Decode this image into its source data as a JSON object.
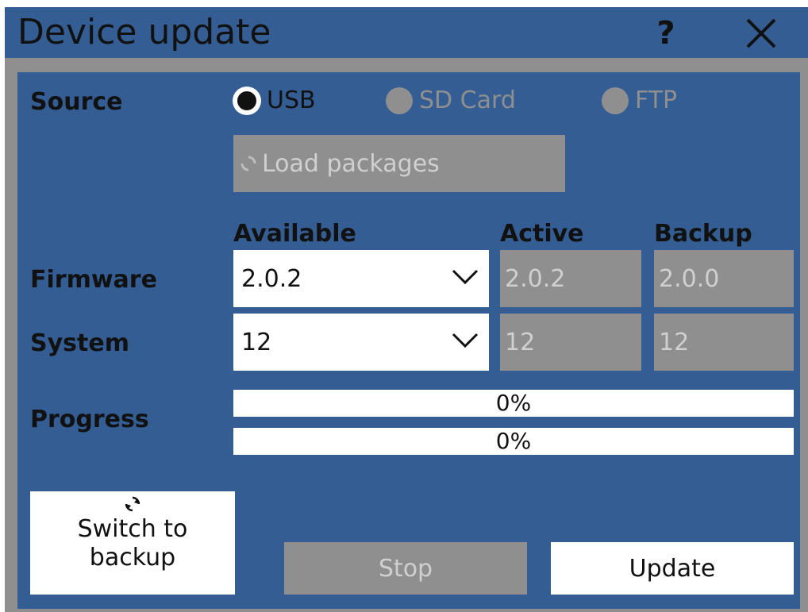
{
  "window": {
    "title": "Device update",
    "help_icon": "question-mark",
    "close_icon": "x-close"
  },
  "source": {
    "label": "Source",
    "options": [
      {
        "label": "USB",
        "selected": true,
        "enabled": true
      },
      {
        "label": "SD Card",
        "selected": false,
        "enabled": false
      },
      {
        "label": "FTP",
        "selected": false,
        "enabled": false
      }
    ]
  },
  "load_packages": {
    "label": "Load packages",
    "icon": "refresh-icon",
    "enabled": false
  },
  "columns": {
    "available": "Available",
    "active": "Active",
    "backup": "Backup"
  },
  "firmware": {
    "label": "Firmware",
    "available": "2.0.2",
    "active": "2.0.2",
    "backup": "2.0.0"
  },
  "system": {
    "label": "System",
    "available": "12",
    "active": "12",
    "backup": "12"
  },
  "progress": {
    "label": "Progress",
    "bars": [
      {
        "percent": 0,
        "text": "0%"
      },
      {
        "percent": 0,
        "text": "0%"
      }
    ]
  },
  "buttons": {
    "switch_line1": "Switch to",
    "switch_line2": "backup",
    "switch_icon": "refresh-icon",
    "stop": "Stop",
    "update": "Update"
  },
  "colors": {
    "panel": "#335d93",
    "frame": "#8f8f8f",
    "disabled_text": "#d0d0d0",
    "text": "#111111"
  }
}
